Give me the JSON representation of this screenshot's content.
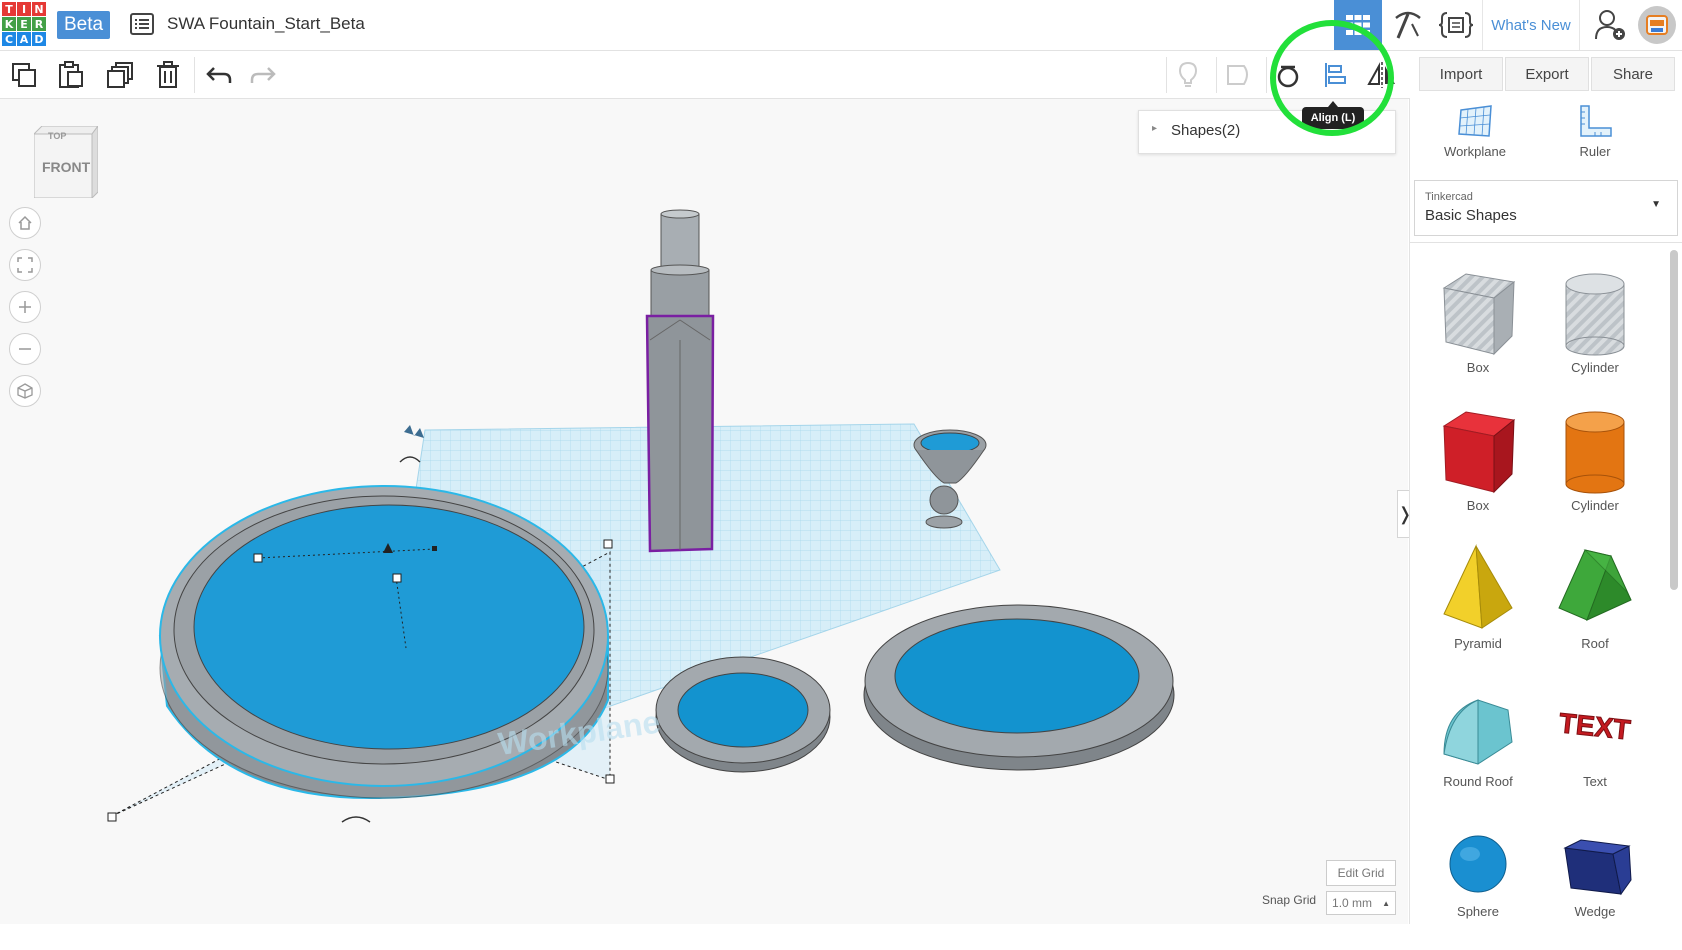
{
  "app": {
    "logo_letters": [
      "T",
      "I",
      "N",
      "K",
      "E",
      "R",
      "C",
      "A",
      "D"
    ],
    "logo_colors": [
      "#e53935",
      "#e53935",
      "#e53935",
      "#43a047",
      "#43a047",
      "#43a047",
      "#1e88e5",
      "#1e88e5",
      "#1e88e5"
    ],
    "beta_label": "Beta",
    "doc_title": "SWA Fountain_Start_Beta",
    "accent": "#4a8fd6"
  },
  "header": {
    "whats_new_label": "What's New",
    "icons": [
      "grid-view-icon",
      "pickaxe-icon",
      "code-blocks-icon",
      "add-user-icon",
      "avatar"
    ]
  },
  "toolbar": {
    "left_icons": [
      "copy-icon",
      "paste-icon",
      "duplicate-icon",
      "delete-icon",
      "undo-icon",
      "redo-icon"
    ],
    "right_icons": [
      "light-bulb-icon",
      "hole-icon",
      "group-icon",
      "align-icon",
      "mirror-icon"
    ],
    "import_label": "Import",
    "export_label": "Export",
    "share_label": "Share",
    "tooltip": "Align (L)"
  },
  "viewport": {
    "viewcube_top": "TOP",
    "viewcube_front": "FRONT",
    "shapes_panel_label": "Shapes(2)",
    "workplane_watermark": "Workplane",
    "edit_grid_label": "Edit Grid",
    "snap_grid_label": "Snap Grid",
    "snap_grid_value": "1.0 mm"
  },
  "right_panel": {
    "workplane_label": "Workplane",
    "ruler_label": "Ruler",
    "library_caption": "Tinkercad",
    "library_value": "Basic Shapes",
    "shapes": [
      {
        "label": "Box",
        "icon": "box-hole-icon"
      },
      {
        "label": "Cylinder",
        "icon": "cylinder-hole-icon"
      },
      {
        "label": "Box",
        "icon": "box-icon"
      },
      {
        "label": "Cylinder",
        "icon": "cylinder-icon"
      },
      {
        "label": "Pyramid",
        "icon": "pyramid-icon"
      },
      {
        "label": "Roof",
        "icon": "roof-icon"
      },
      {
        "label": "Round Roof",
        "icon": "round-roof-icon"
      },
      {
        "label": "Text",
        "icon": "text-icon"
      },
      {
        "label": "Sphere",
        "icon": "sphere-icon"
      },
      {
        "label": "Wedge",
        "icon": "wedge-icon"
      }
    ]
  }
}
